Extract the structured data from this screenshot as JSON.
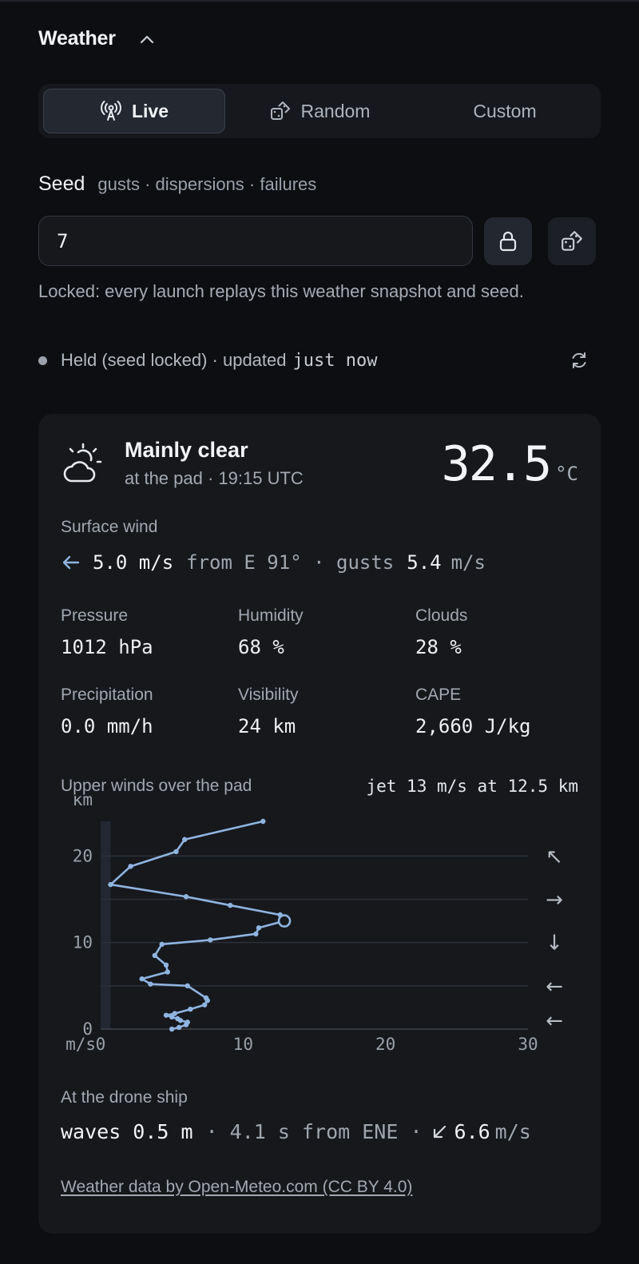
{
  "section": {
    "title": "Weather"
  },
  "modes": {
    "items": [
      {
        "label": "Live",
        "icon": "antenna-icon",
        "active": true
      },
      {
        "label": "Random",
        "icon": "dice-icon",
        "active": false
      },
      {
        "label": "Custom",
        "icon": "",
        "active": false
      }
    ]
  },
  "seed": {
    "label": "Seed",
    "sub": "gusts · dispersions · failures",
    "value": "7",
    "note": "Locked: every launch replays this weather snapshot and seed."
  },
  "status": {
    "text": "Held (seed locked) · updated",
    "time": "just now"
  },
  "current": {
    "condition": "Mainly clear",
    "location_time": "at the pad · 19:15 UTC",
    "temp": "32.5",
    "temp_unit": "°C",
    "wind_label": "Surface wind",
    "wind_speed": "5.0 m/s",
    "wind_from": "from E 91° · gusts",
    "gust_speed": "5.4",
    "gust_unit": "m/s",
    "metrics": [
      {
        "label": "Pressure",
        "value": "1012 hPa"
      },
      {
        "label": "Humidity",
        "value": "68 %"
      },
      {
        "label": "Clouds",
        "value": "28 %"
      },
      {
        "label": "Precipitation",
        "value": "0.0 mm/h"
      },
      {
        "label": "Visibility",
        "value": "24 km"
      },
      {
        "label": "CAPE",
        "value": "2,660 J/kg"
      }
    ]
  },
  "upper_winds": {
    "title": "Upper winds over the pad",
    "jet": "jet 13 m/s at 12.5 km"
  },
  "chart_data": {
    "type": "line",
    "title": "Upper winds over the pad",
    "xlabel": "m/s",
    "ylabel": "km",
    "xlim": [
      0,
      30
    ],
    "ylim": [
      0,
      24
    ],
    "x_ticks": [
      "0",
      "10",
      "20",
      "30"
    ],
    "y_ticks": [
      "0",
      "10",
      "20"
    ],
    "grid": true,
    "series": [
      {
        "x": [
          5.0,
          5.5,
          6.0,
          6.1,
          5.6,
          5.4,
          5.0,
          4.6,
          5.2,
          6.3,
          7.3,
          7.5,
          7.4,
          6.1,
          3.5,
          2.9,
          4.7,
          4.6,
          3.8,
          4.3,
          7.7,
          10.9,
          11.1,
          12.9,
          12.6,
          9.1,
          6.0,
          0.7,
          2.1,
          5.3,
          5.9,
          11.4
        ],
        "y": [
          0.0,
          0.2,
          0.5,
          0.8,
          1.0,
          1.2,
          1.4,
          1.6,
          1.8,
          2.3,
          2.8,
          3.3,
          3.6,
          5.0,
          5.2,
          5.8,
          6.6,
          7.4,
          8.5,
          9.8,
          10.3,
          11.0,
          11.7,
          12.5,
          13.2,
          14.3,
          15.3,
          16.7,
          18.8,
          20.5,
          21.9,
          24.0
        ],
        "highlight_index": 23
      }
    ],
    "direction_arrows": [
      {
        "km": 20,
        "arrow": "↖"
      },
      {
        "km": 15,
        "arrow": "→"
      },
      {
        "km": 10,
        "arrow": "↓"
      },
      {
        "km": 5,
        "arrow": "←"
      },
      {
        "km": 1,
        "arrow": "←"
      }
    ]
  },
  "ship": {
    "label": "At the drone ship",
    "waves": "waves 0.5 m",
    "detail": "· 4.1 s from ENE ·",
    "wind": "6.6",
    "wind_unit": "m/s"
  },
  "attribution": "Weather data by Open-Meteo.com (CC BY 4.0)",
  "colors": {
    "accent": "#8fb4e0",
    "background": "#0d0e11",
    "card": "#16181c"
  }
}
